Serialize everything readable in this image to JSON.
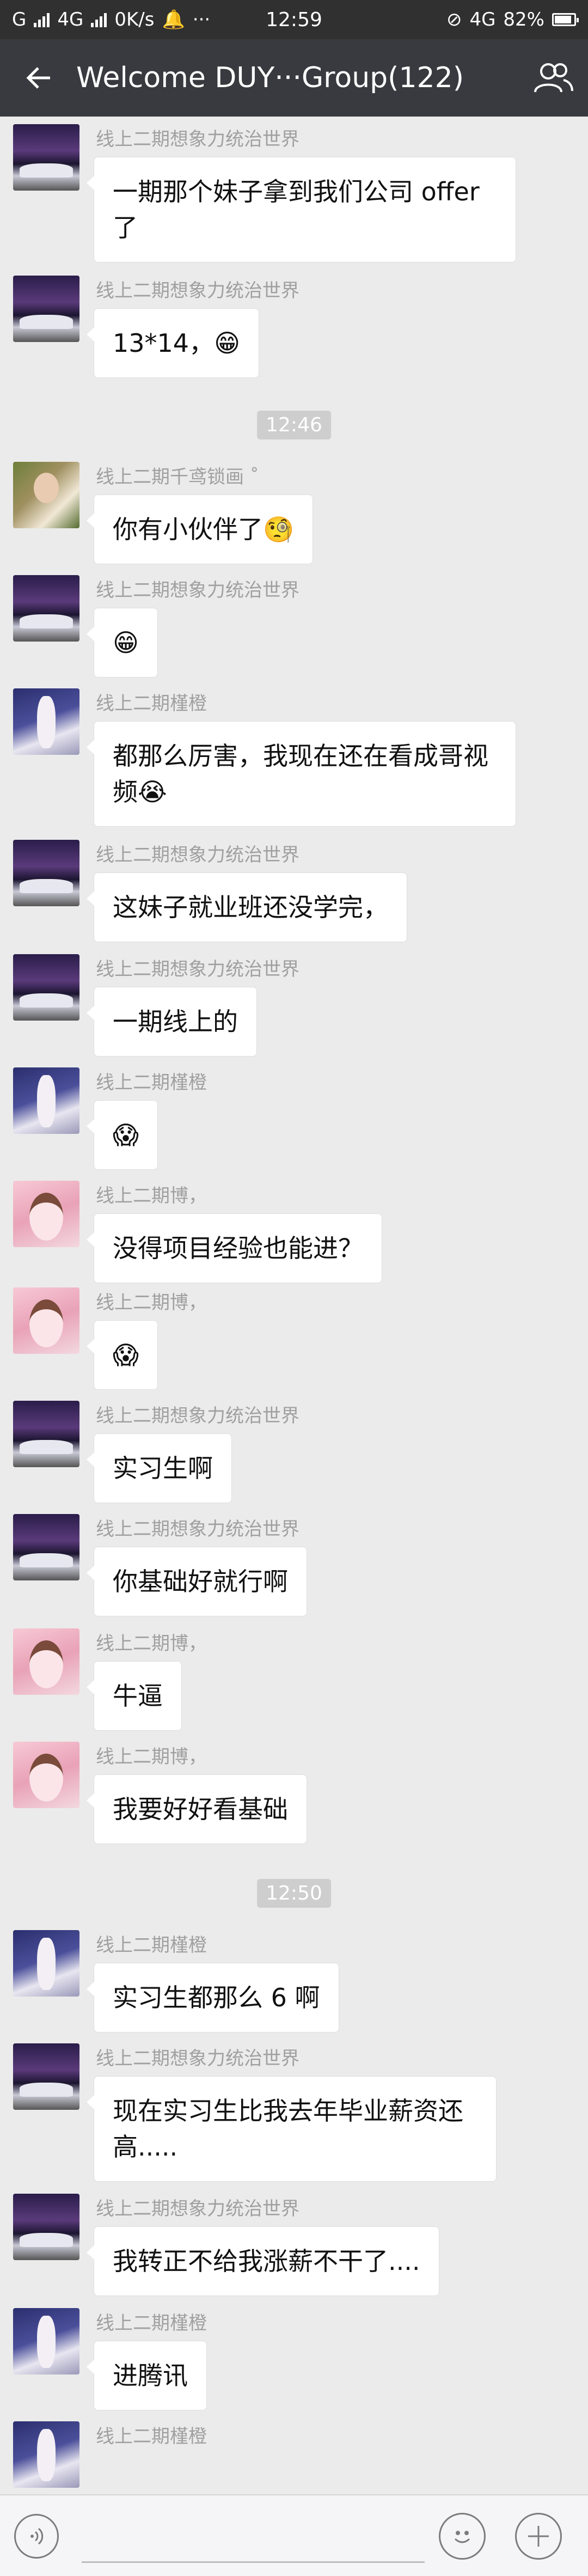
{
  "status_bar": {
    "carrier_left": "G",
    "network": "4G",
    "speed": "0K/s",
    "more": "···",
    "time": "12:59",
    "network_right": "4G",
    "battery": "82%"
  },
  "header": {
    "back_icon": "arrow-left-icon",
    "title": "Welcome DUY···Group(122)",
    "members_icon": "group-members-icon"
  },
  "messages": [
    {
      "sender": "线上二期想象力统治世界",
      "avatar": "car",
      "text": "一期那个妹子拿到我们公司 offer 了"
    },
    {
      "sender": "线上二期想象力统治世界",
      "avatar": "car",
      "text": "13*14，😁"
    },
    {
      "type": "time",
      "text": "12:46"
    },
    {
      "sender": "线上二期千鸢锁画 ˚",
      "avatar": "photo",
      "text": "你有小伙伴了🧐"
    },
    {
      "sender": "线上二期想象力统治世界",
      "avatar": "car",
      "text": "😁"
    },
    {
      "sender": "线上二期槿橙",
      "avatar": "girl",
      "text": "都那么厉害，我现在还在看成哥视频😭"
    },
    {
      "sender": "线上二期想象力统治世界",
      "avatar": "car",
      "text": "这妹子就业班还没学完，"
    },
    {
      "sender": "线上二期想象力统治世界",
      "avatar": "car",
      "text": "一期线上的"
    },
    {
      "sender": "线上二期槿橙",
      "avatar": "girl",
      "text": "😱"
    },
    {
      "sender": "线上二期博，",
      "avatar": "anime",
      "text": "没得项目经验也能进？"
    },
    {
      "sender": "线上二期博，",
      "avatar": "anime",
      "text": "😱"
    },
    {
      "sender": "线上二期想象力统治世界",
      "avatar": "car",
      "text": "实习生啊"
    },
    {
      "sender": "线上二期想象力统治世界",
      "avatar": "car",
      "text": "你基础好就行啊"
    },
    {
      "sender": "线上二期博，",
      "avatar": "anime",
      "text": "牛逼"
    },
    {
      "sender": "线上二期博，",
      "avatar": "anime",
      "text": "我要好好看基础"
    },
    {
      "type": "time",
      "text": "12:50"
    },
    {
      "sender": "线上二期槿橙",
      "avatar": "girl",
      "text": "实习生都那么 6 啊"
    },
    {
      "sender": "线上二期想象力统治世界",
      "avatar": "car",
      "text": "现在实习生比我去年毕业薪资还高....."
    },
    {
      "sender": "线上二期想象力统治世界",
      "avatar": "car",
      "text": "我转正不给我涨薪不干了...."
    },
    {
      "sender": "线上二期槿橙",
      "avatar": "girl",
      "text": "进腾讯"
    },
    {
      "sender": "线上二期槿橙",
      "avatar": "girl",
      "text": ""
    }
  ],
  "input_bar": {
    "voice_icon": "voice-icon",
    "emoji_icon": "emoji-icon",
    "plus_icon": "plus-icon",
    "placeholder": ""
  },
  "colors": {
    "title_bar": "#393a3f",
    "status_bar": "#303030",
    "chat_bg": "#ebebeb",
    "bubble": "#ffffff"
  }
}
